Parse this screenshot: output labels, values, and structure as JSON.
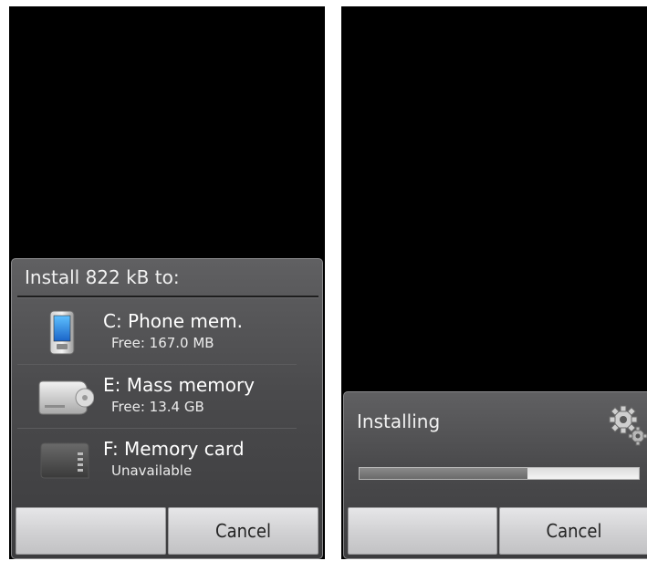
{
  "install_dialog": {
    "title": "Install 822 kB to:",
    "options": [
      {
        "title": "C: Phone mem.",
        "subtitle": "Free: 167.0 MB",
        "icon": "phone-icon"
      },
      {
        "title": "E: Mass memory",
        "subtitle": "Free: 13.4 GB",
        "icon": "mass-memory-drive-icon"
      },
      {
        "title": "F: Memory card",
        "subtitle": "Unavailable",
        "icon": "memory-card-icon"
      }
    ],
    "left_softkey": "",
    "cancel_label": "Cancel"
  },
  "progress_dialog": {
    "title": "Installing",
    "icon": "gears-icon",
    "progress": 0.6,
    "left_softkey": "",
    "cancel_label": "Cancel"
  }
}
